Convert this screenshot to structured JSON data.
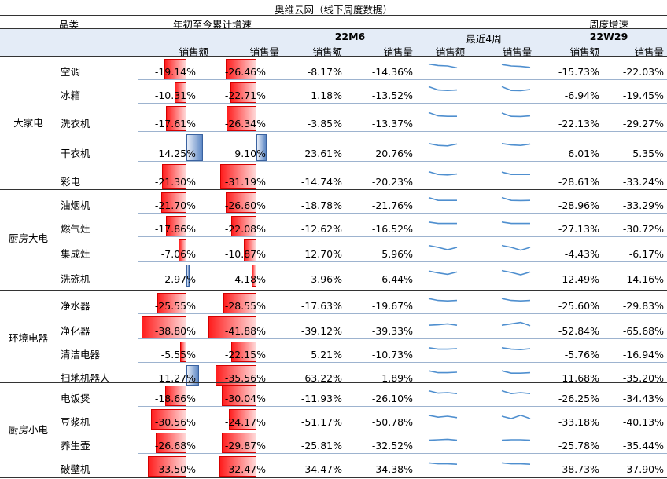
{
  "title": "奥维云网（线下周度数据）",
  "headers": {
    "category": "品类",
    "ytd": "年初至今累计增速",
    "weekly": "周度增速",
    "period_m": "22M6",
    "recent": "最近4周",
    "period_w": "22W29",
    "sales_amount": "销售额",
    "sales_volume": "销售量"
  },
  "colors": {
    "negative_bar": "#ff1e1e",
    "positive_bar": "#5b86c4",
    "sparkline": "#4f8fcf",
    "grid": "#9db3cf"
  },
  "groups": [
    {
      "name": "大家电",
      "rows": [
        {
          "item": "空调",
          "ytd_amt": "-19.14%",
          "ytd_vol": "-26.46%",
          "m_amt": "-8.17%",
          "m_vol": "-14.36%",
          "w_amt": "-15.73%",
          "w_vol": "-22.03%",
          "ytd_amt_v": -19.14,
          "ytd_vol_v": -26.46,
          "spark_amt": [
            0.3,
            0.45,
            0.5,
            0.7
          ],
          "spark_vol": [
            0.35,
            0.5,
            0.55,
            0.65
          ]
        },
        {
          "item": "冰箱",
          "ytd_amt": "-10.31%",
          "ytd_vol": "-22.71%",
          "m_amt": "1.18%",
          "m_vol": "-13.52%",
          "w_amt": "-6.94%",
          "w_vol": "-19.45%",
          "ytd_amt_v": -10.31,
          "ytd_vol_v": -22.71,
          "spark_amt": [
            0.2,
            0.55,
            0.6,
            0.55
          ],
          "spark_vol": [
            0.2,
            0.6,
            0.62,
            0.5
          ]
        },
        {
          "item": "洗衣机",
          "ytd_amt": "-17.61%",
          "ytd_vol": "-26.34%",
          "m_amt": "-3.85%",
          "m_vol": "-13.37%",
          "w_amt": "-22.13%",
          "w_vol": "-29.27%",
          "ytd_amt_v": -17.61,
          "ytd_vol_v": -26.34,
          "spark_amt": [
            0.2,
            0.55,
            0.6,
            0.6
          ],
          "spark_vol": [
            0.25,
            0.6,
            0.62,
            0.55
          ]
        },
        {
          "item": "干衣机",
          "ytd_amt": "14.25%",
          "ytd_vol": "9.10%",
          "m_amt": "23.61%",
          "m_vol": "20.76%",
          "w_amt": "6.01%",
          "w_vol": "5.35%",
          "ytd_amt_v": 14.25,
          "ytd_vol_v": 9.1,
          "spark_amt": [
            0.4,
            0.6,
            0.65,
            0.45
          ],
          "spark_vol": [
            0.4,
            0.55,
            0.6,
            0.45
          ]
        },
        {
          "item": "彩电",
          "ytd_amt": "-21.30%",
          "ytd_vol": "-31.19%",
          "m_amt": "-14.74%",
          "m_vol": "-20.23%",
          "w_amt": "-28.61%",
          "w_vol": "-33.24%",
          "ytd_amt_v": -21.3,
          "ytd_vol_v": -31.19,
          "spark_amt": [
            0.3,
            0.6,
            0.65,
            0.55
          ],
          "spark_vol": [
            0.35,
            0.6,
            0.6,
            0.6
          ]
        }
      ]
    },
    {
      "name": "厨房大电",
      "rows": [
        {
          "item": "油烟机",
          "ytd_amt": "-21.70%",
          "ytd_vol": "-26.60%",
          "m_amt": "-18.78%",
          "m_vol": "-21.76%",
          "w_amt": "-28.96%",
          "w_vol": "-33.29%",
          "ytd_amt_v": -21.7,
          "ytd_vol_v": -26.6,
          "spark_amt": [
            0.3,
            0.6,
            0.6,
            0.6
          ],
          "spark_vol": [
            0.3,
            0.6,
            0.62,
            0.6
          ]
        },
        {
          "item": "燃气灶",
          "ytd_amt": "-17.86%",
          "ytd_vol": "-22.08%",
          "m_amt": "-12.62%",
          "m_vol": "-16.52%",
          "w_amt": "-27.13%",
          "w_vol": "-30.72%",
          "ytd_amt_v": -17.86,
          "ytd_vol_v": -22.08,
          "spark_amt": [
            0.4,
            0.55,
            0.55,
            0.55
          ],
          "spark_vol": [
            0.4,
            0.55,
            0.55,
            0.55
          ]
        },
        {
          "item": "集成灶",
          "ytd_amt": "-7.06%",
          "ytd_vol": "-10.87%",
          "m_amt": "12.70%",
          "m_vol": "5.96%",
          "w_amt": "-4.43%",
          "w_vol": "-6.17%",
          "ytd_amt_v": -7.06,
          "ytd_vol_v": -10.87,
          "spark_amt": [
            0.3,
            0.5,
            0.75,
            0.5
          ],
          "spark_vol": [
            0.3,
            0.5,
            0.8,
            0.5
          ]
        },
        {
          "item": "洗碗机",
          "ytd_amt": "2.97%",
          "ytd_vol": "-4.18%",
          "m_amt": "-3.96%",
          "m_vol": "-6.44%",
          "w_amt": "-12.49%",
          "w_vol": "-14.16%",
          "ytd_amt_v": 2.97,
          "ytd_vol_v": -4.18,
          "spark_amt": [
            0.35,
            0.55,
            0.7,
            0.45
          ],
          "spark_vol": [
            0.3,
            0.5,
            0.75,
            0.45
          ]
        }
      ]
    },
    {
      "name": "环境电器",
      "rows": [
        {
          "item": "净水器",
          "ytd_amt": "-25.55%",
          "ytd_vol": "-28.55%",
          "m_amt": "-17.63%",
          "m_vol": "-19.67%",
          "w_amt": "-25.60%",
          "w_vol": "-29.83%",
          "ytd_amt_v": -25.55,
          "ytd_vol_v": -28.55,
          "spark_amt": [
            0.35,
            0.55,
            0.6,
            0.55
          ],
          "spark_vol": [
            0.35,
            0.55,
            0.6,
            0.55
          ]
        },
        {
          "item": "净化器",
          "ytd_amt": "-38.80%",
          "ytd_vol": "-41.88%",
          "m_amt": "-39.12%",
          "m_vol": "-39.33%",
          "w_amt": "-52.84%",
          "w_vol": "-65.68%",
          "ytd_amt_v": -38.8,
          "ytd_vol_v": -41.88,
          "spark_amt": [
            0.6,
            0.55,
            0.45,
            0.6
          ],
          "spark_vol": [
            0.6,
            0.45,
            0.3,
            0.65
          ]
        },
        {
          "item": "清洁电器",
          "ytd_amt": "-5.55%",
          "ytd_vol": "-22.15%",
          "m_amt": "5.21%",
          "m_vol": "-10.73%",
          "w_amt": "-5.76%",
          "w_vol": "-16.94%",
          "ytd_amt_v": -5.55,
          "ytd_vol_v": -22.15,
          "spark_amt": [
            0.4,
            0.55,
            0.55,
            0.5
          ],
          "spark_vol": [
            0.4,
            0.55,
            0.6,
            0.5
          ]
        },
        {
          "item": "扫地机器人",
          "ytd_amt": "11.27%",
          "ytd_vol": "-35.56%",
          "m_amt": "63.22%",
          "m_vol": "1.89%",
          "w_amt": "11.68%",
          "w_vol": "-35.20%",
          "ytd_amt_v": 11.27,
          "ytd_vol_v": -35.56,
          "spark_amt": [
            0.35,
            0.55,
            0.55,
            0.5
          ],
          "spark_vol": [
            0.35,
            0.6,
            0.6,
            0.55
          ]
        }
      ]
    },
    {
      "name": "厨房小电",
      "rows": [
        {
          "item": "电饭煲",
          "ytd_amt": "-18.66%",
          "ytd_vol": "-30.04%",
          "m_amt": "-11.93%",
          "m_vol": "-26.10%",
          "w_amt": "-26.25%",
          "w_vol": "-34.43%",
          "ytd_amt_v": -18.66,
          "ytd_vol_v": -30.04,
          "spark_amt": [
            0.3,
            0.55,
            0.5,
            0.6
          ],
          "spark_vol": [
            0.3,
            0.6,
            0.5,
            0.6
          ]
        },
        {
          "item": "豆浆机",
          "ytd_amt": "-30.56%",
          "ytd_vol": "-24.17%",
          "m_amt": "-51.17%",
          "m_vol": "-50.78%",
          "w_amt": "-33.18%",
          "w_vol": "-40.13%",
          "ytd_amt_v": -30.56,
          "ytd_vol_v": -24.17,
          "spark_amt": [
            0.4,
            0.6,
            0.5,
            0.65
          ],
          "spark_vol": [
            0.5,
            0.75,
            0.4,
            0.75
          ]
        },
        {
          "item": "养生壶",
          "ytd_amt": "-26.68%",
          "ytd_vol": "-29.87%",
          "m_amt": "-25.81%",
          "m_vol": "-32.52%",
          "w_amt": "-25.78%",
          "w_vol": "-35.44%",
          "ytd_amt_v": -26.68,
          "ytd_vol_v": -29.87,
          "spark_amt": [
            0.55,
            0.5,
            0.45,
            0.55
          ],
          "spark_vol": [
            0.55,
            0.5,
            0.5,
            0.55
          ]
        },
        {
          "item": "破壁机",
          "ytd_amt": "-33.50%",
          "ytd_vol": "-32.47%",
          "m_amt": "-34.47%",
          "m_vol": "-34.38%",
          "w_amt": "-38.73%",
          "w_vol": "-37.90%",
          "ytd_amt_v": -33.5,
          "ytd_vol_v": -32.47,
          "spark_amt": [
            0.45,
            0.55,
            0.55,
            0.6
          ],
          "spark_vol": [
            0.45,
            0.55,
            0.55,
            0.6
          ]
        }
      ]
    }
  ]
}
